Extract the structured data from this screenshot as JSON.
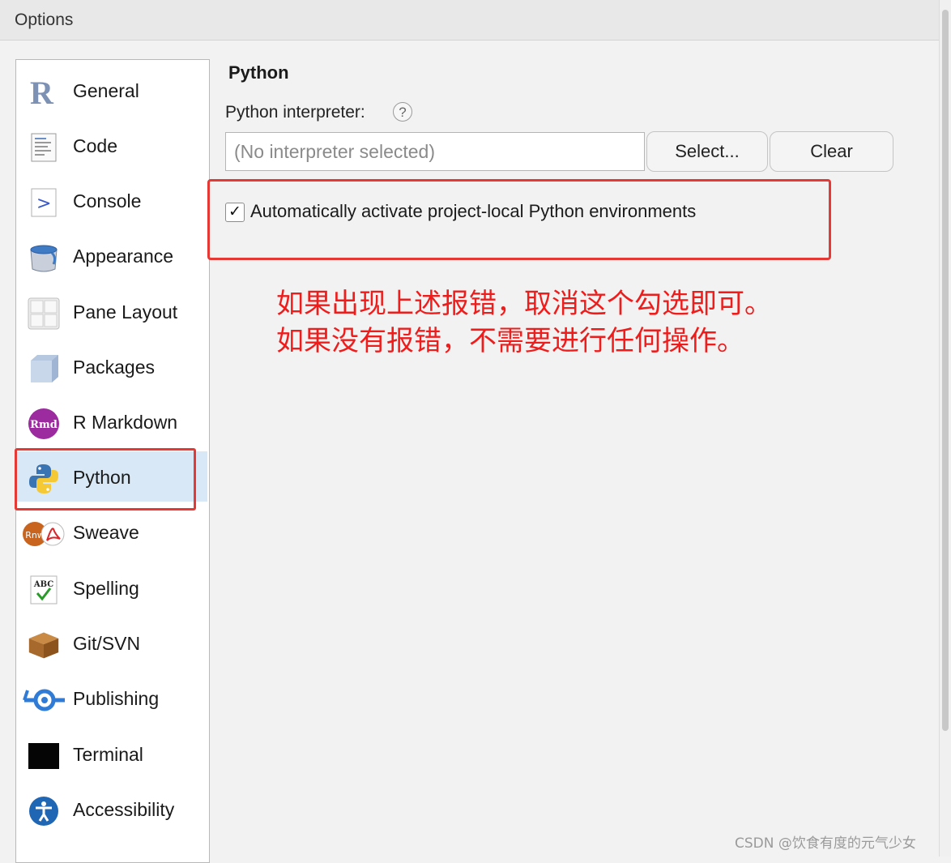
{
  "window": {
    "title": "Options"
  },
  "sidebar": {
    "selected": "Python",
    "items": [
      {
        "label": "General",
        "icon": "r-logo-icon"
      },
      {
        "label": "Code",
        "icon": "code-icon"
      },
      {
        "label": "Console",
        "icon": "console-icon"
      },
      {
        "label": "Appearance",
        "icon": "paint-bucket-icon"
      },
      {
        "label": "Pane Layout",
        "icon": "pane-layout-icon"
      },
      {
        "label": "Packages",
        "icon": "packages-icon"
      },
      {
        "label": "R Markdown",
        "icon": "rmd-icon"
      },
      {
        "label": "Python",
        "icon": "python-icon"
      },
      {
        "label": "Sweave",
        "icon": "sweave-icon"
      },
      {
        "label": "Spelling",
        "icon": "spelling-icon"
      },
      {
        "label": "Git/SVN",
        "icon": "git-svn-icon"
      },
      {
        "label": "Publishing",
        "icon": "publishing-icon"
      },
      {
        "label": "Terminal",
        "icon": "terminal-icon"
      },
      {
        "label": "Accessibility",
        "icon": "accessibility-icon"
      }
    ]
  },
  "python": {
    "title": "Python",
    "interpreter_label": "Python interpreter:",
    "help_glyph": "?",
    "interpreter_value": "(No interpreter selected)",
    "select_button": "Select...",
    "clear_button": "Clear",
    "auto_activate_label": "Automatically activate project-local Python environments",
    "auto_activate_checked": true
  },
  "annotation": {
    "line1": "如果出现上述报错，取消这个勾选即可。",
    "line2": "如果没有报错，不需要进行任何操作。",
    "color": "#ef1c1c"
  },
  "watermark": "CSDN @饮食有度的元气少女"
}
